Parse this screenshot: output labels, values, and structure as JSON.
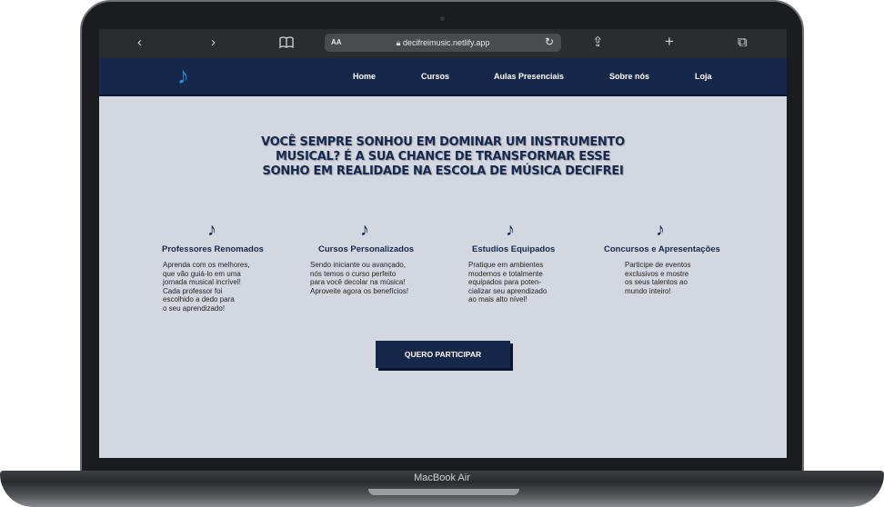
{
  "browser": {
    "back": "‹",
    "forward": "›",
    "bookmarks_icon": "book-icon",
    "reader": "AA",
    "url": "decifreimusic.netlify.app",
    "reload": "↻",
    "share": "⇪",
    "new_tab": "+",
    "tabs": "⧉"
  },
  "site": {
    "logo_glyph": "♪",
    "nav": [
      "Home",
      "Cursos",
      "Aulas Presenciais",
      "Sobre nós",
      "Loja"
    ],
    "hero_title": "VOCÊ SEMPRE SONHOU EM DOMINAR UM INSTRUMENTO MUSICAL? É A SUA CHANCE DE TRANSFORMAR ESSE SONHO EM REALIDADE NA ESCOLA DE MÚSICA DECIFREI",
    "features": [
      {
        "icon": "♪",
        "title": "Professores Renomados",
        "desc": [
          "Aprenda com os melhores,",
          "que vão guiá-lo em uma",
          "jornada musical incrível!",
          "Cada professor foi",
          "escolhido a dedo para",
          "o seu aprendizado!"
        ]
      },
      {
        "icon": "♪",
        "title": "Cursos Personalizados",
        "desc": [
          "Sendo iniciante ou avançado,",
          "nós temos o curso perfeito",
          "para você decolar na música!",
          "Aproveite agora os benefícios!"
        ]
      },
      {
        "icon": "♪",
        "title": "Estudios Equipados",
        "desc": [
          "Pratique em ambientes",
          "modernos e totalmente",
          "equipados para poten-",
          "cializar seu aprendizado",
          "ao mais alto nível!"
        ]
      },
      {
        "icon": "♪",
        "title": "Concursos e Apresentações",
        "desc": [
          "Participe de eventos",
          "exclusivos e mostre",
          "os seus talentos ao",
          "mundo inteiro!"
        ]
      }
    ],
    "cta_label": "QUERO PARTICIPAR"
  },
  "device": {
    "model": "MacBook Air"
  },
  "colors": {
    "nav_bg": "#15284a",
    "page_bg": "#d3d8e0",
    "logo": "#1e90e6",
    "text_dark": "#16284b"
  }
}
